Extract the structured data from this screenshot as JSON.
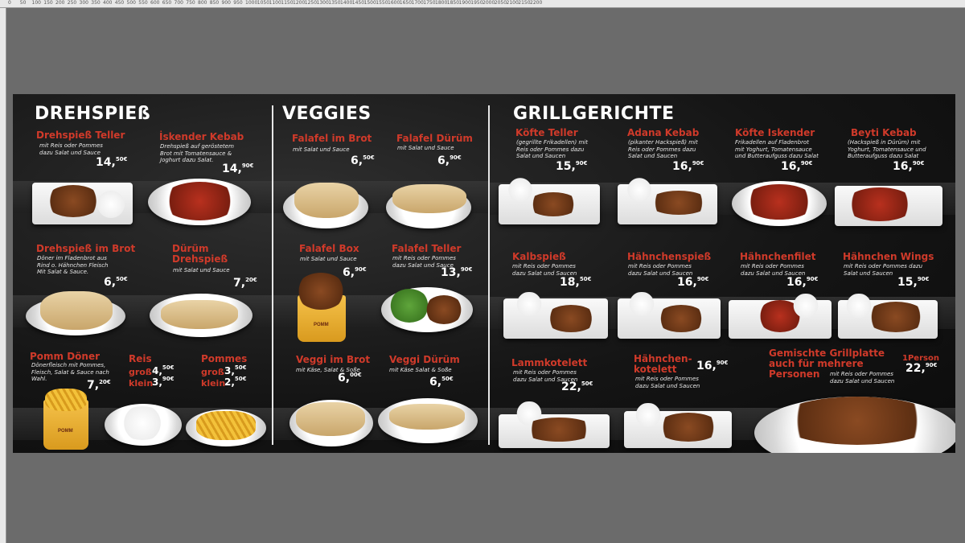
{
  "ruler": {
    "ticks": [
      "0",
      "50",
      "100",
      "150",
      "200",
      "250",
      "300",
      "350",
      "400",
      "450",
      "500",
      "550",
      "600",
      "650",
      "700",
      "750",
      "800",
      "850",
      "900",
      "950",
      "1000",
      "1050",
      "1100",
      "1150",
      "1200",
      "1250",
      "1300",
      "1350",
      "1400",
      "1450",
      "1500",
      "1550",
      "1600",
      "1650",
      "1700",
      "1750",
      "1800",
      "1850",
      "1900",
      "1950",
      "2000",
      "2050",
      "2100",
      "2150",
      "2200"
    ]
  },
  "sections": {
    "drehspiess": "DREHSPIEß",
    "veggies": "VEGGIES",
    "grill": "GRILLGERICHTE"
  },
  "items": {
    "d1": {
      "name": "Drehspieß Teller",
      "desc": "mit Reis oder Pommes dazu Salat und Sauce",
      "price": "14,",
      "cents": "50€"
    },
    "d2": {
      "name": "İskender Kebab",
      "desc": "Drehspieß auf geröstetem Brot mit Tomatensauce & Joghurt dazu Salat.",
      "price": "14,",
      "cents": "90€"
    },
    "d3": {
      "name": "Drehspieß im Brot",
      "desc": "Döner im Fladenbrot aus Rind o. Hähnchen Fleisch Mit Salat & Sauce.",
      "price": "6,",
      "cents": "50€"
    },
    "d4": {
      "name": "Dürüm Drehspieß",
      "desc": "mit Salat und Sauce",
      "price": "7,",
      "cents": "20€"
    },
    "d5": {
      "name": "Pomm Döner",
      "desc": "Dönerfleisch mit Pommes, Fleisch, Salat & Sauce nach Wahl.",
      "price": "7,",
      "cents": "20€"
    },
    "reis": {
      "name": "Reis",
      "gross": "groß",
      "klein": "klein",
      "p1": "4,",
      "c1": "50€",
      "p2": "3,",
      "c2": "90€"
    },
    "pommes": {
      "name": "Pommes",
      "gross": "groß",
      "klein": "klein",
      "p1": "3,",
      "c1": "50€",
      "p2": "2,",
      "c2": "50€"
    },
    "v1": {
      "name": "Falafel im Brot",
      "desc": "mit Salat und Sauce",
      "price": "6,",
      "cents": "50€"
    },
    "v2": {
      "name": "Falafel Dürüm",
      "desc": "mit Salat und Sauce",
      "price": "6,",
      "cents": "90€"
    },
    "v3": {
      "name": "Falafel Box",
      "desc": "mit Salat und Sauce",
      "price": "6,",
      "cents": "90€"
    },
    "v4": {
      "name": "Falafel Teller",
      "desc": "mit Reis oder Pommes dazu Salat und Sauce",
      "price": "13,",
      "cents": "90€"
    },
    "v5": {
      "name": "Veggi im Brot",
      "desc": "mit Käse, Salat & Soße",
      "price": "6,",
      "cents": "00€"
    },
    "v6": {
      "name": "Veggi Dürüm",
      "desc": "mit Käse Salat & Soße",
      "price": "6,",
      "cents": "50€"
    },
    "g1": {
      "name": "Köfte Teller",
      "desc": "(gegrillte Frikadellen) mit Reis oder Pommes dazu Salat und Saucen",
      "price": "15,",
      "cents": "90€"
    },
    "g2": {
      "name": "Adana Kebab",
      "desc": "(pikanter Hackspieß) mit Reis oder Pommes dazu Salat und Saucen",
      "price": "16,",
      "cents": "90€"
    },
    "g3": {
      "name": "Köfte Iskender",
      "desc": "Frikadellen auf Fladenbrot mit Yoghurt, Tomatensauce und Butteraufguss dazu Salat",
      "price": "16,",
      "cents": "90€"
    },
    "g4": {
      "name": "Beyti Kebab",
      "desc": "(Hackspieß in Dürüm) mit Yoghurt, Tomatensauce und Butteraufguss dazu Salat",
      "price": "16,",
      "cents": "90€"
    },
    "g5": {
      "name": "Kalbspieß",
      "desc": "mit Reis oder Pommes dazu Salat und Saucen",
      "price": "18,",
      "cents": "50€"
    },
    "g6": {
      "name": "Hähnchenspieß",
      "desc": "mit Reis oder Pommes dazu Salat und Saucen",
      "price": "16,",
      "cents": "90€"
    },
    "g7": {
      "name": "Hähnchenfilet",
      "desc": "mit Reis oder Pommes dazu Salat und Saucen",
      "price": "16,",
      "cents": "90€"
    },
    "g8": {
      "name": "Hähnchen Wings",
      "desc": "mit Reis oder Pommes dazu Salat und Saucen",
      "price": "15,",
      "cents": "90€"
    },
    "g9": {
      "name": "Lammkotelett",
      "desc": "mit Reis oder Pommes dazu Salat und Saucen",
      "price": "22,",
      "cents": "50€"
    },
    "g10": {
      "name": "Hähnchen-kotelett",
      "desc": "mit Reis oder Pommes dazu Salat und Saucen",
      "price": "16,",
      "cents": "90€"
    },
    "g11": {
      "name": "Gemischte Grillplatte auch für mehrere Personen",
      "desc": "mit Reis oder Pommes dazu Salat und Saucen",
      "person": "1Person",
      "price": "22,",
      "cents": "90€"
    }
  },
  "box_logo": "POMM"
}
